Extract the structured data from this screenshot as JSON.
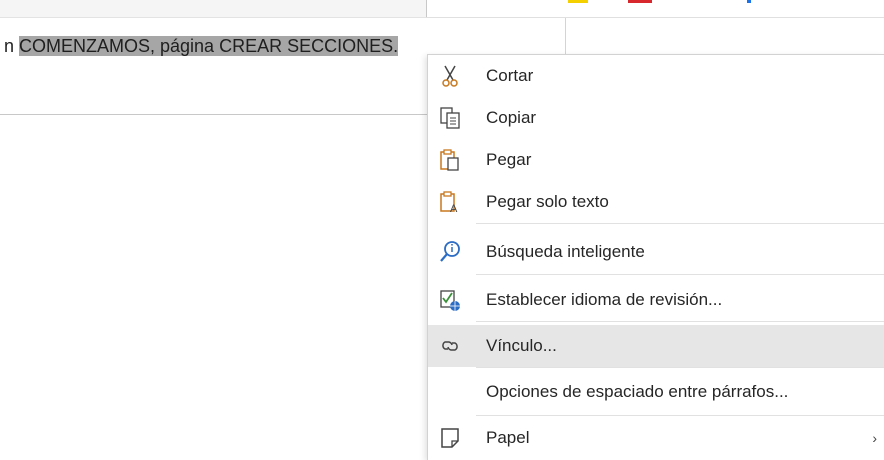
{
  "document": {
    "text_prefix": "n ",
    "selected_text": "COMENZAMOS, página CREAR SECCIONES."
  },
  "colors": {
    "selection": "#a6a6a6",
    "hover": "#e6e6e6",
    "accent_orange": "#c8781e",
    "accent_blue": "#2b6cc4"
  },
  "context_menu": {
    "items": [
      {
        "label": "Cortar",
        "icon": "scissors-icon"
      },
      {
        "label": "Copiar",
        "icon": "copy-icon"
      },
      {
        "label": "Pegar",
        "icon": "paste-icon"
      },
      {
        "label": "Pegar solo texto",
        "icon": "paste-text-icon"
      },
      {
        "label": "Búsqueda inteligente",
        "icon": "smart-lookup-icon"
      },
      {
        "label": "Establecer idioma de revisión...",
        "icon": "proofing-language-icon"
      },
      {
        "label": "Vínculo...",
        "icon": "link-icon"
      },
      {
        "label": "Opciones de espaciado entre párrafos...",
        "icon": ""
      },
      {
        "label": "Papel",
        "icon": "paper-icon",
        "submenu_arrow": "›"
      }
    ]
  }
}
